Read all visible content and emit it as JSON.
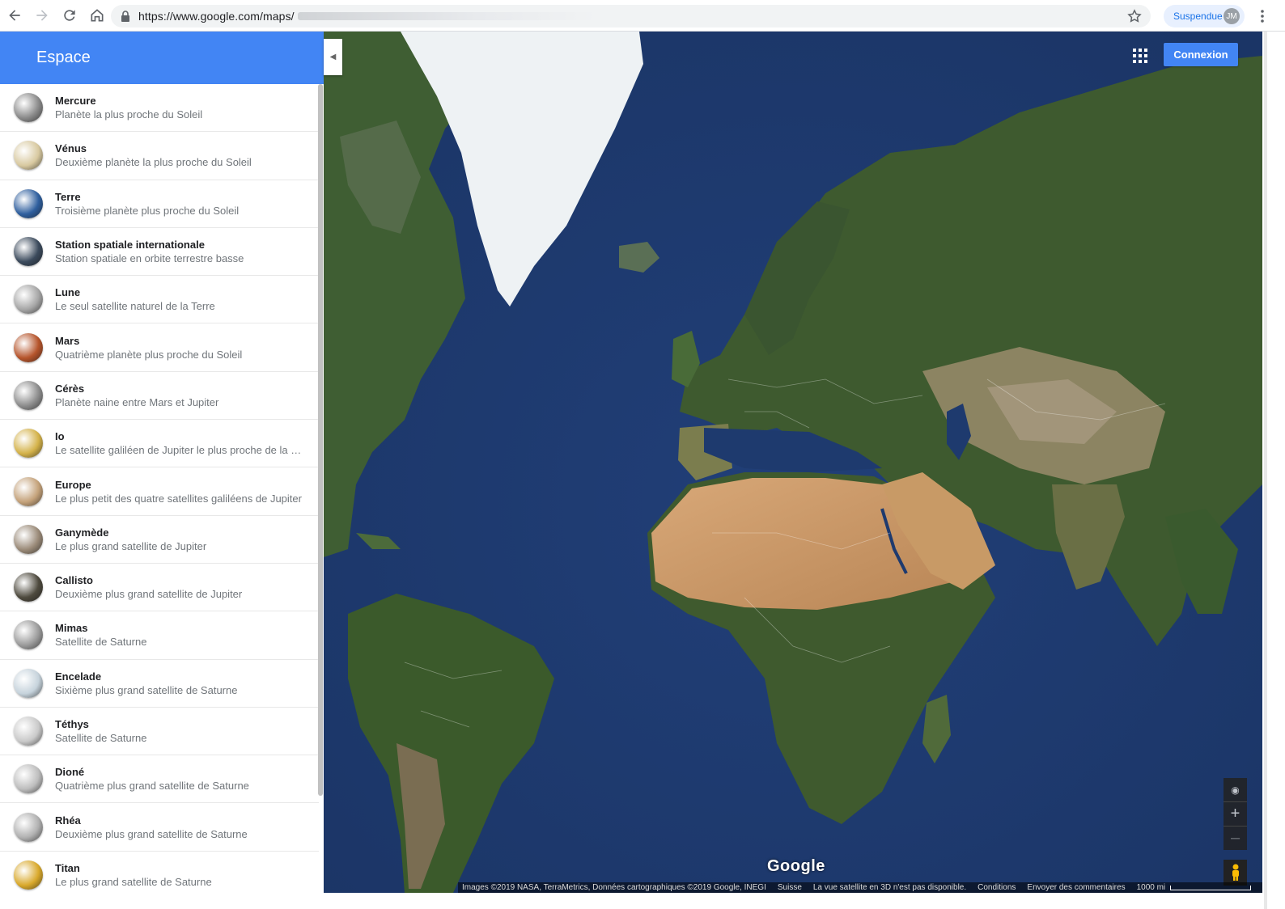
{
  "browser": {
    "url": "https://www.google.com/maps/",
    "profile_label": "Suspendue",
    "profile_initials": "JM"
  },
  "sidebar": {
    "title": "Espace",
    "items": [
      {
        "name": "Mercure",
        "desc": "Planète la plus proche du Soleil",
        "color": "#8a8a8a"
      },
      {
        "name": "Vénus",
        "desc": "Deuxième planète la plus proche du Soleil",
        "color": "#d8c9a0"
      },
      {
        "name": "Terre",
        "desc": "Troisième planète plus proche du Soleil",
        "color": "#2f5f9e"
      },
      {
        "name": "Station spatiale internationale",
        "desc": "Station spatiale en orbite terrestre basse",
        "color": "#3b4a5c"
      },
      {
        "name": "Lune",
        "desc": "Le seul satellite naturel de la Terre",
        "color": "#a6a6a6"
      },
      {
        "name": "Mars",
        "desc": "Quatrième planète plus proche du Soleil",
        "color": "#b5542b"
      },
      {
        "name": "Cérès",
        "desc": "Planète naine entre Mars et Jupiter",
        "color": "#8d8d8d"
      },
      {
        "name": "Io",
        "desc": "Le satellite galiléen de Jupiter le plus proche de la planète",
        "color": "#d4b24a"
      },
      {
        "name": "Europe",
        "desc": "Le plus petit des quatre satellites galiléens de Jupiter",
        "color": "#c4a27a"
      },
      {
        "name": "Ganymède",
        "desc": "Le plus grand satellite de Jupiter",
        "color": "#9a8a78"
      },
      {
        "name": "Callisto",
        "desc": "Deuxième plus grand satellite de Jupiter",
        "color": "#4e4a3e"
      },
      {
        "name": "Mimas",
        "desc": "Satellite de Saturne",
        "color": "#9b9b9b"
      },
      {
        "name": "Encelade",
        "desc": "Sixième plus grand satellite de Saturne",
        "color": "#c6d3dc"
      },
      {
        "name": "Téthys",
        "desc": "Satellite de Saturne",
        "color": "#c9c9c9"
      },
      {
        "name": "Dioné",
        "desc": "Quatrième plus grand satellite de Saturne",
        "color": "#bdbdbd"
      },
      {
        "name": "Rhéa",
        "desc": "Deuxième plus grand satellite de Saturne",
        "color": "#b0b0b0"
      },
      {
        "name": "Titan",
        "desc": "Le plus grand satellite de Saturne",
        "color": "#d9a92c"
      }
    ]
  },
  "map": {
    "signin_label": "Connexion",
    "logo_text": "Google",
    "attribution": "Images ©2019 NASA, TerraMetrics, Données cartographiques ©2019 Google, INEGI",
    "region_link": "Suisse",
    "notice_3d": "La vue satellite en 3D n'est pas disponible.",
    "terms_link": "Conditions",
    "feedback_link": "Envoyer des commentaires",
    "scale_label": "1000 mi"
  },
  "colors": {
    "header_blue": "#4285f4",
    "ocean": "#1f3f74",
    "land_green": "#3d5a2c",
    "desert": "#c99a6a",
    "ice": "#eef2f4"
  }
}
